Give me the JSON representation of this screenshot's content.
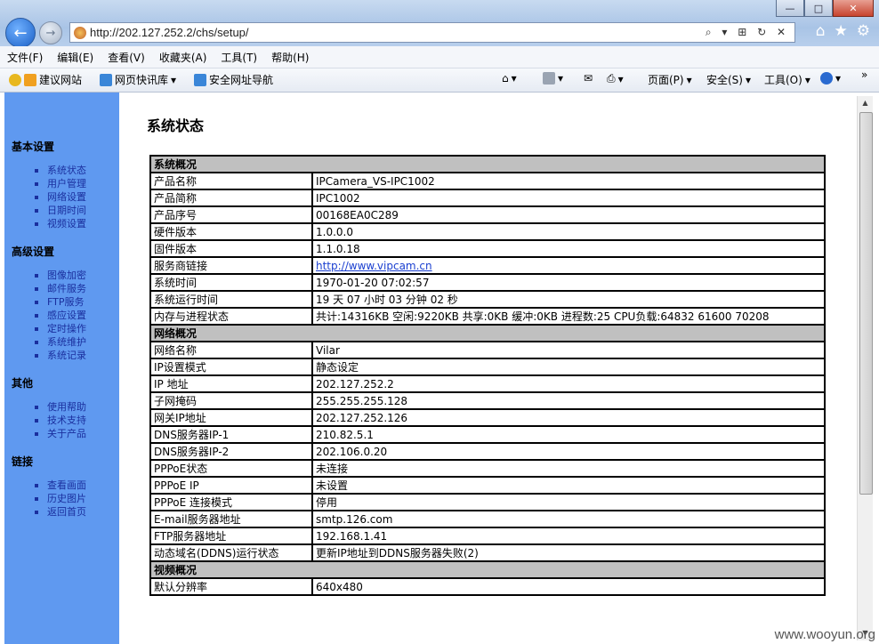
{
  "browser": {
    "url": "http://202.127.252.2/chs/setup/",
    "window_buttons": [
      "—",
      "□",
      "✕"
    ],
    "address_actions": "⌕ ▾ ⊞ ↻ ✕",
    "right_icons": [
      "⌂",
      "★",
      "⚙"
    ],
    "back_icon": "←",
    "forward_icon": "→"
  },
  "menubar": [
    "文件(F)",
    "编辑(E)",
    "查看(V)",
    "收藏夹(A)",
    "工具(T)",
    "帮助(H)"
  ],
  "favbar": {
    "suggested": "建议网站",
    "webslice": "网页快讯库",
    "safe_nav": "安全网址导航",
    "page": "页面(P)",
    "safety": "安全(S)",
    "tools": "工具(O)",
    "more": "»"
  },
  "sidebar": {
    "sections": [
      {
        "title": "基本设置",
        "items": [
          "系统状态",
          "用户管理",
          "网络设置",
          "日期时间",
          "视频设置"
        ]
      },
      {
        "title": "高级设置",
        "items": [
          "图像加密",
          "邮件服务",
          "FTP服务",
          "感应设置",
          "定时操作",
          "系统维护",
          "系统记录"
        ]
      },
      {
        "title": "其他",
        "items": [
          "使用帮助",
          "技术支持",
          "关于产品"
        ]
      },
      {
        "title": "链接",
        "items": [
          "查看画面",
          "历史图片",
          "返回首页"
        ]
      }
    ]
  },
  "page_title": "系统状态",
  "table": [
    {
      "type": "head",
      "label": "系统概况"
    },
    {
      "k": "产品名称",
      "v": "IPCamera_VS-IPC1002"
    },
    {
      "k": "产品简称",
      "v": "IPC1002"
    },
    {
      "k": "产品序号",
      "v": "00168EA0C289"
    },
    {
      "k": "硬件版本",
      "v": "1.0.0.0"
    },
    {
      "k": "固件版本",
      "v": "1.1.0.18"
    },
    {
      "k": "服务商链接",
      "v": "http://www.vipcam.cn",
      "link": true
    },
    {
      "k": "系统时间",
      "v": "1970-01-20 07:02:57"
    },
    {
      "k": "系统运行时间",
      "v": "19 天 07 小时 03 分钟 02 秒"
    },
    {
      "k": "内存与进程状态",
      "v": "共计:14316KB 空闲:9220KB 共享:0KB 缓冲:0KB 进程数:25 CPU负载:64832 61600 70208"
    },
    {
      "type": "head",
      "label": "网络概况"
    },
    {
      "k": "网络名称",
      "v": "Vilar"
    },
    {
      "k": "IP设置模式",
      "v": "静态设定"
    },
    {
      "k": "IP 地址",
      "v": "202.127.252.2"
    },
    {
      "k": "子网掩码",
      "v": "255.255.255.128"
    },
    {
      "k": "网关IP地址",
      "v": "202.127.252.126"
    },
    {
      "k": "DNS服务器IP-1",
      "v": "210.82.5.1"
    },
    {
      "k": "DNS服务器IP-2",
      "v": "202.106.0.20"
    },
    {
      "k": "PPPoE状态",
      "v": "未连接"
    },
    {
      "k": "PPPoE IP",
      "v": "未设置"
    },
    {
      "k": "PPPoE 连接模式",
      "v": "停用"
    },
    {
      "k": "E-mail服务器地址",
      "v": "smtp.126.com"
    },
    {
      "k": "FTP服务器地址",
      "v": "192.168.1.41"
    },
    {
      "k": "动态域名(DDNS)运行状态",
      "v": "更新IP地址到DDNS服务器失败(2)"
    },
    {
      "type": "head",
      "label": "视频概况"
    },
    {
      "k": "默认分辨率",
      "v": "640x480"
    }
  ],
  "watermark": "www.wooyun.org"
}
